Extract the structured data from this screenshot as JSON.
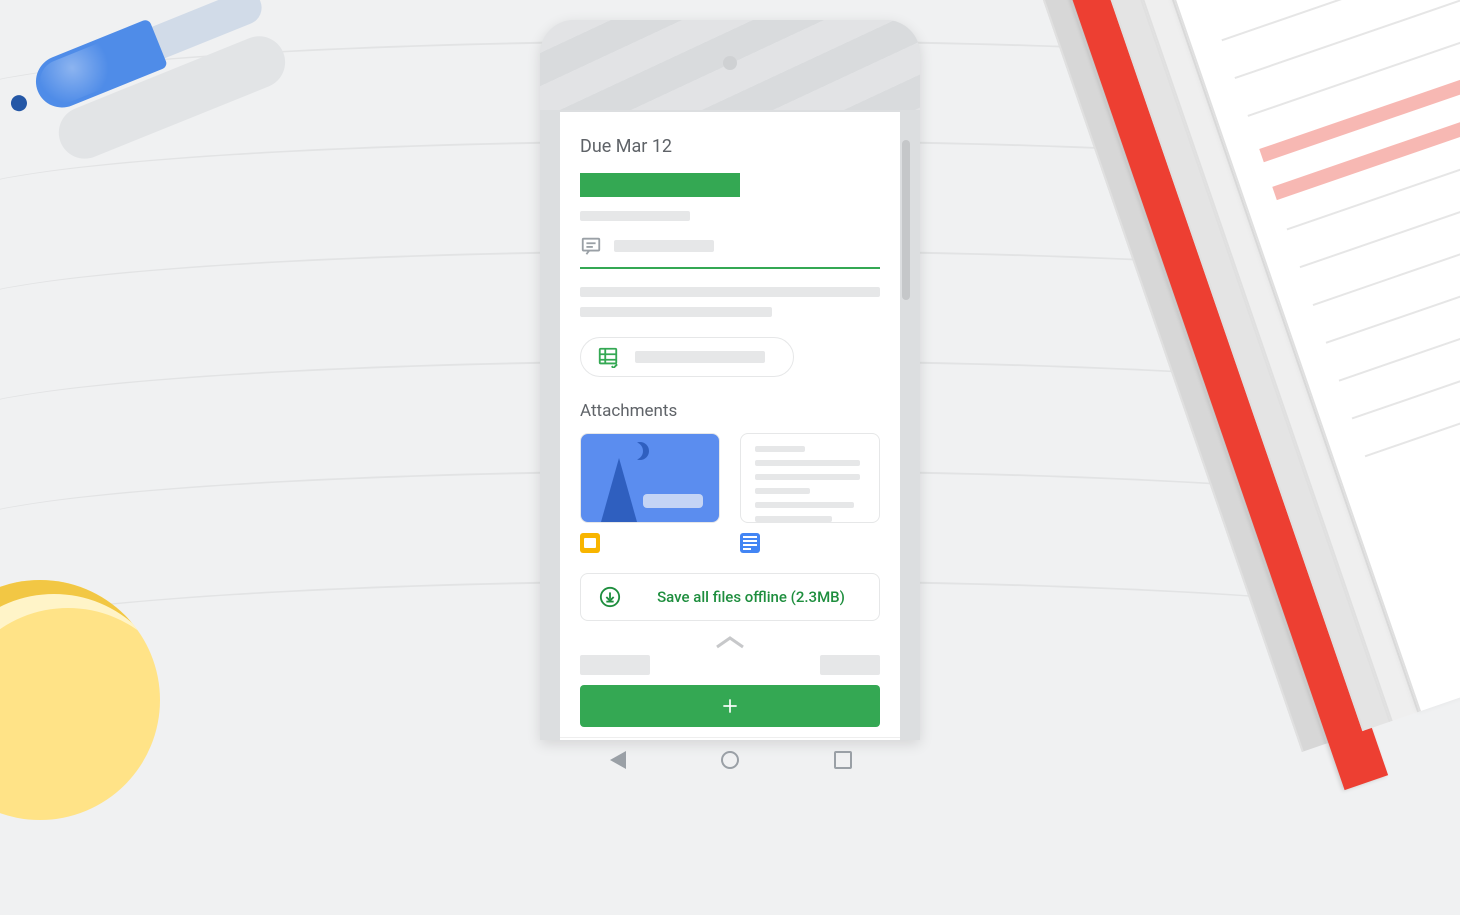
{
  "assignment": {
    "due_label": "Due Mar 12",
    "attachments_label": "Attachments"
  },
  "offline": {
    "label": "Save all files offline (2.3MB)"
  },
  "icons": {
    "comment": "comment-icon",
    "rubric": "rubric-icon",
    "slides": "slides-file-icon",
    "docs": "docs-file-icon",
    "download": "download-icon",
    "add": "plus-icon",
    "nav_back": "nav-back-icon",
    "nav_home": "nav-home-icon",
    "nav_recents": "nav-recents-icon"
  },
  "colors": {
    "accent": "#34a853",
    "slides_thumb": "#5b8def",
    "slides_file": "#f8b500",
    "docs_file": "#4285f4",
    "bookmark": "#ed3f32"
  }
}
